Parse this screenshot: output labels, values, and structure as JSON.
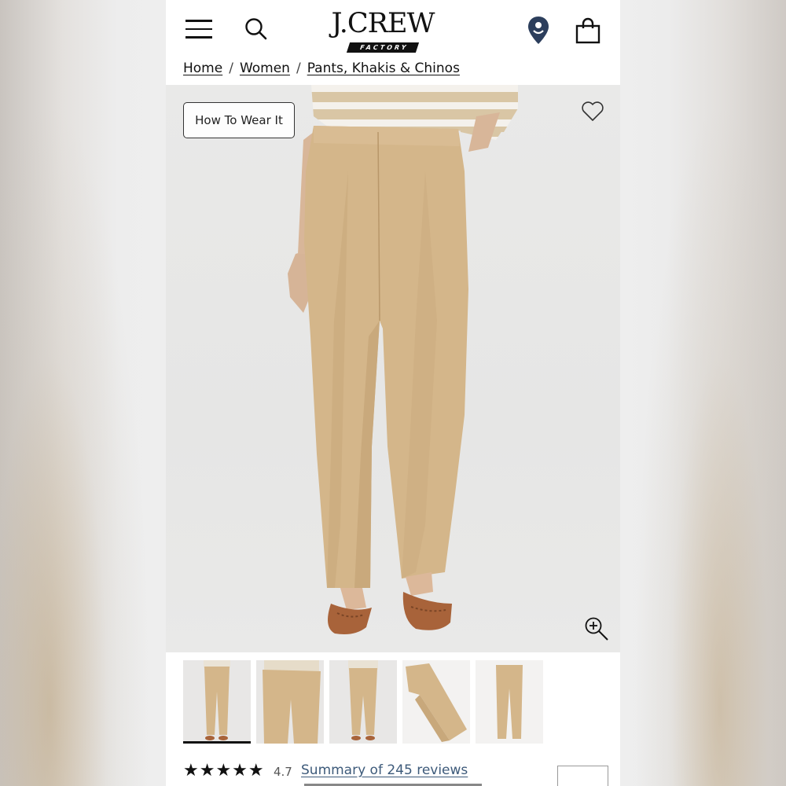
{
  "header": {
    "logo_text": "J.CREW",
    "logo_sub": "FACTORY",
    "icons": [
      "menu-icon",
      "search-icon",
      "location-icon",
      "shopping-bag-icon"
    ]
  },
  "breadcrumb": {
    "items": [
      "Home",
      "Women",
      "Pants, Khakis & Chinos"
    ],
    "separator": "/"
  },
  "hero": {
    "how_to_wear_label": "How To Wear It",
    "icons": [
      "heart-icon",
      "zoom-in-icon"
    ]
  },
  "thumbnails": {
    "count": 5,
    "active_index": 0
  },
  "rating": {
    "stars": "★★★★★",
    "value": "4.7",
    "reviews_link": "Summary of 245 reviews"
  },
  "colors": {
    "pants": "#d4b68a",
    "shoes": "#a8633a",
    "link": "#3d5a7a",
    "location_pin": "#2c3e5c"
  }
}
